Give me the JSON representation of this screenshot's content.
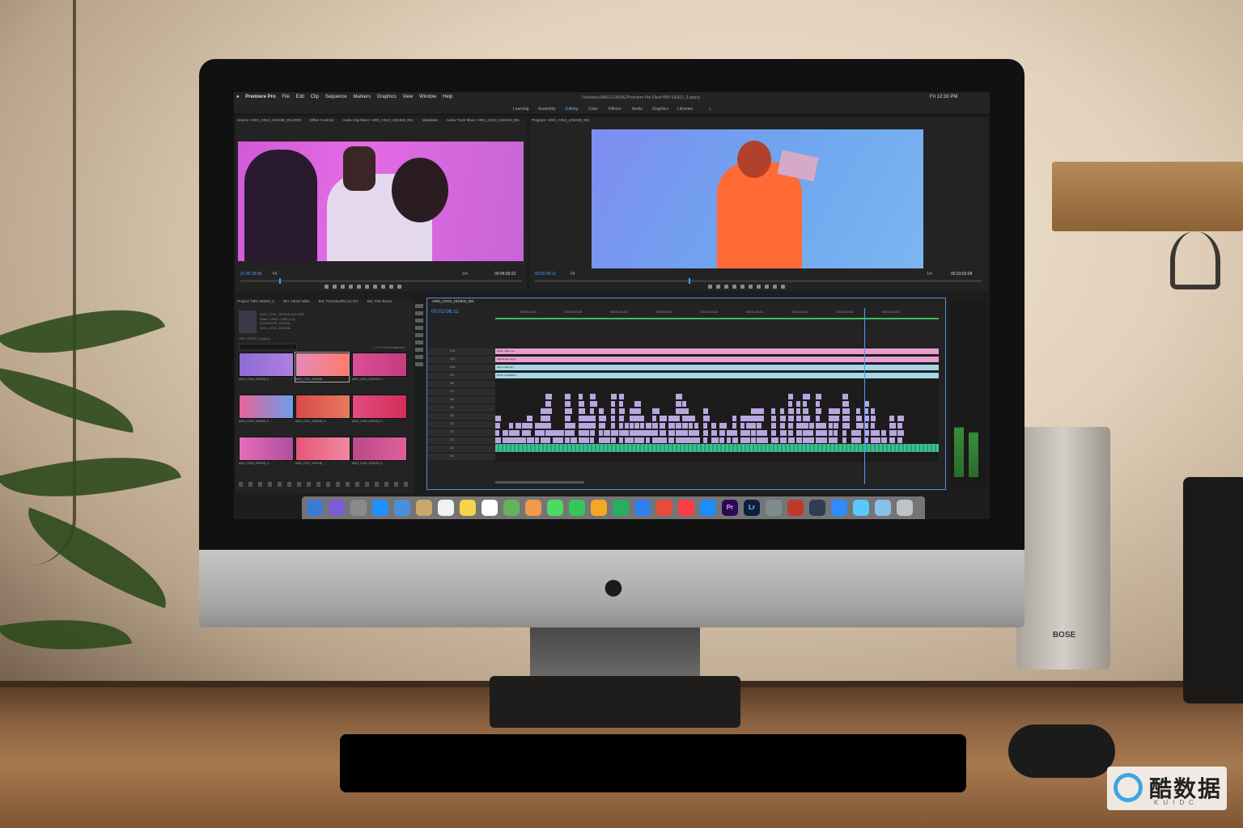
{
  "menubar": {
    "apple": "",
    "app_name": "Premiere Pro",
    "menus": [
      "File",
      "Edit",
      "Clip",
      "Sequence",
      "Markers",
      "Graphics",
      "View",
      "Window",
      "Help"
    ],
    "file_path": "/Volumes/JAKES DRIVE/Premiere Pro Files/YBN VIDEO_3.prproj",
    "clock": "Fri 12:30 PM"
  },
  "workspaces": [
    "Learning",
    "Assembly",
    "Editing",
    "Color",
    "Effects",
    "Audio",
    "Graphics",
    "Libraries",
    "»"
  ],
  "source_panel": {
    "tabs": [
      "Source: A001_C013_1024H8_001.R3D",
      "Effect Controls",
      "Audio Clip Mixer: A001_C013_1024H8_001",
      "Metadata",
      "Audio Track Mixer: A001_C013_1024H8_001"
    ],
    "timecode_in": "21:45:28:06",
    "fit": "Fit",
    "resolution": "1/4",
    "timecode_out": "00:04:09:22"
  },
  "program_panel": {
    "tab": "Program: A001_C013_1024H8_001",
    "timecode_in": "00:02:06:11",
    "fit": "Fit",
    "resolution": "1/4",
    "timecode_out": "00:23:03:04"
  },
  "project_panel": {
    "tabs": [
      "Project: YBN VIDEO_3",
      "Bin: 16mm Stills",
      "Bin: FILM BURN (11-37)",
      "Bin: Film Burns"
    ],
    "selected_clip": "A001_C011_1024H8_001.R3D",
    "clip_info": [
      "Video, 1920 x 1080 (1.0)",
      "00:00:09:22, 23.976p",
      "A001_C011_1024H8..."
    ],
    "file_label": "YBN VIDEO_3.prproj",
    "items_selected": "1 of 71 items selected",
    "clips": [
      {
        "name": "A001_C010_1024H8_0...",
        "dur": "5:20:01"
      },
      {
        "name": "A001_C011_1024H8...",
        "dur": "4:02:21"
      },
      {
        "name": "A001_C012_1024H8_0...",
        "dur": "2:19"
      },
      {
        "name": "A001_C013_1024H8_0...",
        "dur": "5:13:19"
      },
      {
        "name": "A001_C014_1024H8_0...",
        "dur": "4:13:00"
      },
      {
        "name": "A001_C015_1024H8_0...",
        "dur": "7:43:21"
      },
      {
        "name": "A001_C016_1024H8_0...",
        "dur": "5:22:00"
      },
      {
        "name": "A001_C017_1024H8_...",
        "dur": "9:41:00"
      },
      {
        "name": "A001_C018_1024H8_0...",
        "dur": "2:04:19"
      }
    ]
  },
  "timeline": {
    "sequence_name": "A001_C013_1024H8_001",
    "timecode": "00:02:06:11",
    "ruler": [
      "00:00:14:23",
      "00:00:29:23",
      "00:00:44:23",
      "00:00:59:22",
      "00:01:14:22",
      "00:01:29:21",
      "00:01:44:21",
      "00:01:59:21",
      "00:02:14:20"
    ],
    "tracks": [
      "V13",
      "V12",
      "V11",
      "V10",
      "V9",
      "V8",
      "V7",
      "V6",
      "V5",
      "V4",
      "V3",
      "V2",
      "V1",
      "A1",
      "A2",
      "A3"
    ],
    "clip_labels": {
      "adjustment": "Adjustment Layer",
      "dust": "DUST & SCRATC",
      "glitch": "Glitch_Stills.mov",
      "stills": "16mm 160 [pic]"
    }
  },
  "dock": {
    "icons": [
      "finder-icon",
      "siri-icon",
      "launchpad-icon",
      "safari-icon",
      "mail-icon",
      "contacts-icon",
      "calendar-icon",
      "notes-icon",
      "reminders-icon",
      "maps-icon",
      "photos-icon",
      "messages-icon",
      "facetime-icon",
      "pages-icon",
      "numbers-icon",
      "keynote-icon",
      "news-icon",
      "music-icon",
      "app-store-icon",
      "premiere-icon",
      "lightroom-icon",
      "system-preferences-icon",
      "photo-booth-icon",
      "quicktime-icon",
      "zoom-icon",
      "preview-icon",
      "folder-icon",
      "trash-icon"
    ],
    "premiere_label": "Pr",
    "lightroom_label": "Lr"
  },
  "hardware": {
    "speaker_brand": "BOSE",
    "watermark_text": "酷数据",
    "watermark_sub": "KUIDC"
  },
  "colors": {
    "accent": "#4a9cff",
    "clip_purple": "#b9a6e0",
    "clip_pink": "#e69fcf",
    "clip_teal": "#a4d6e8",
    "audio_green": "#3fbd8e"
  }
}
